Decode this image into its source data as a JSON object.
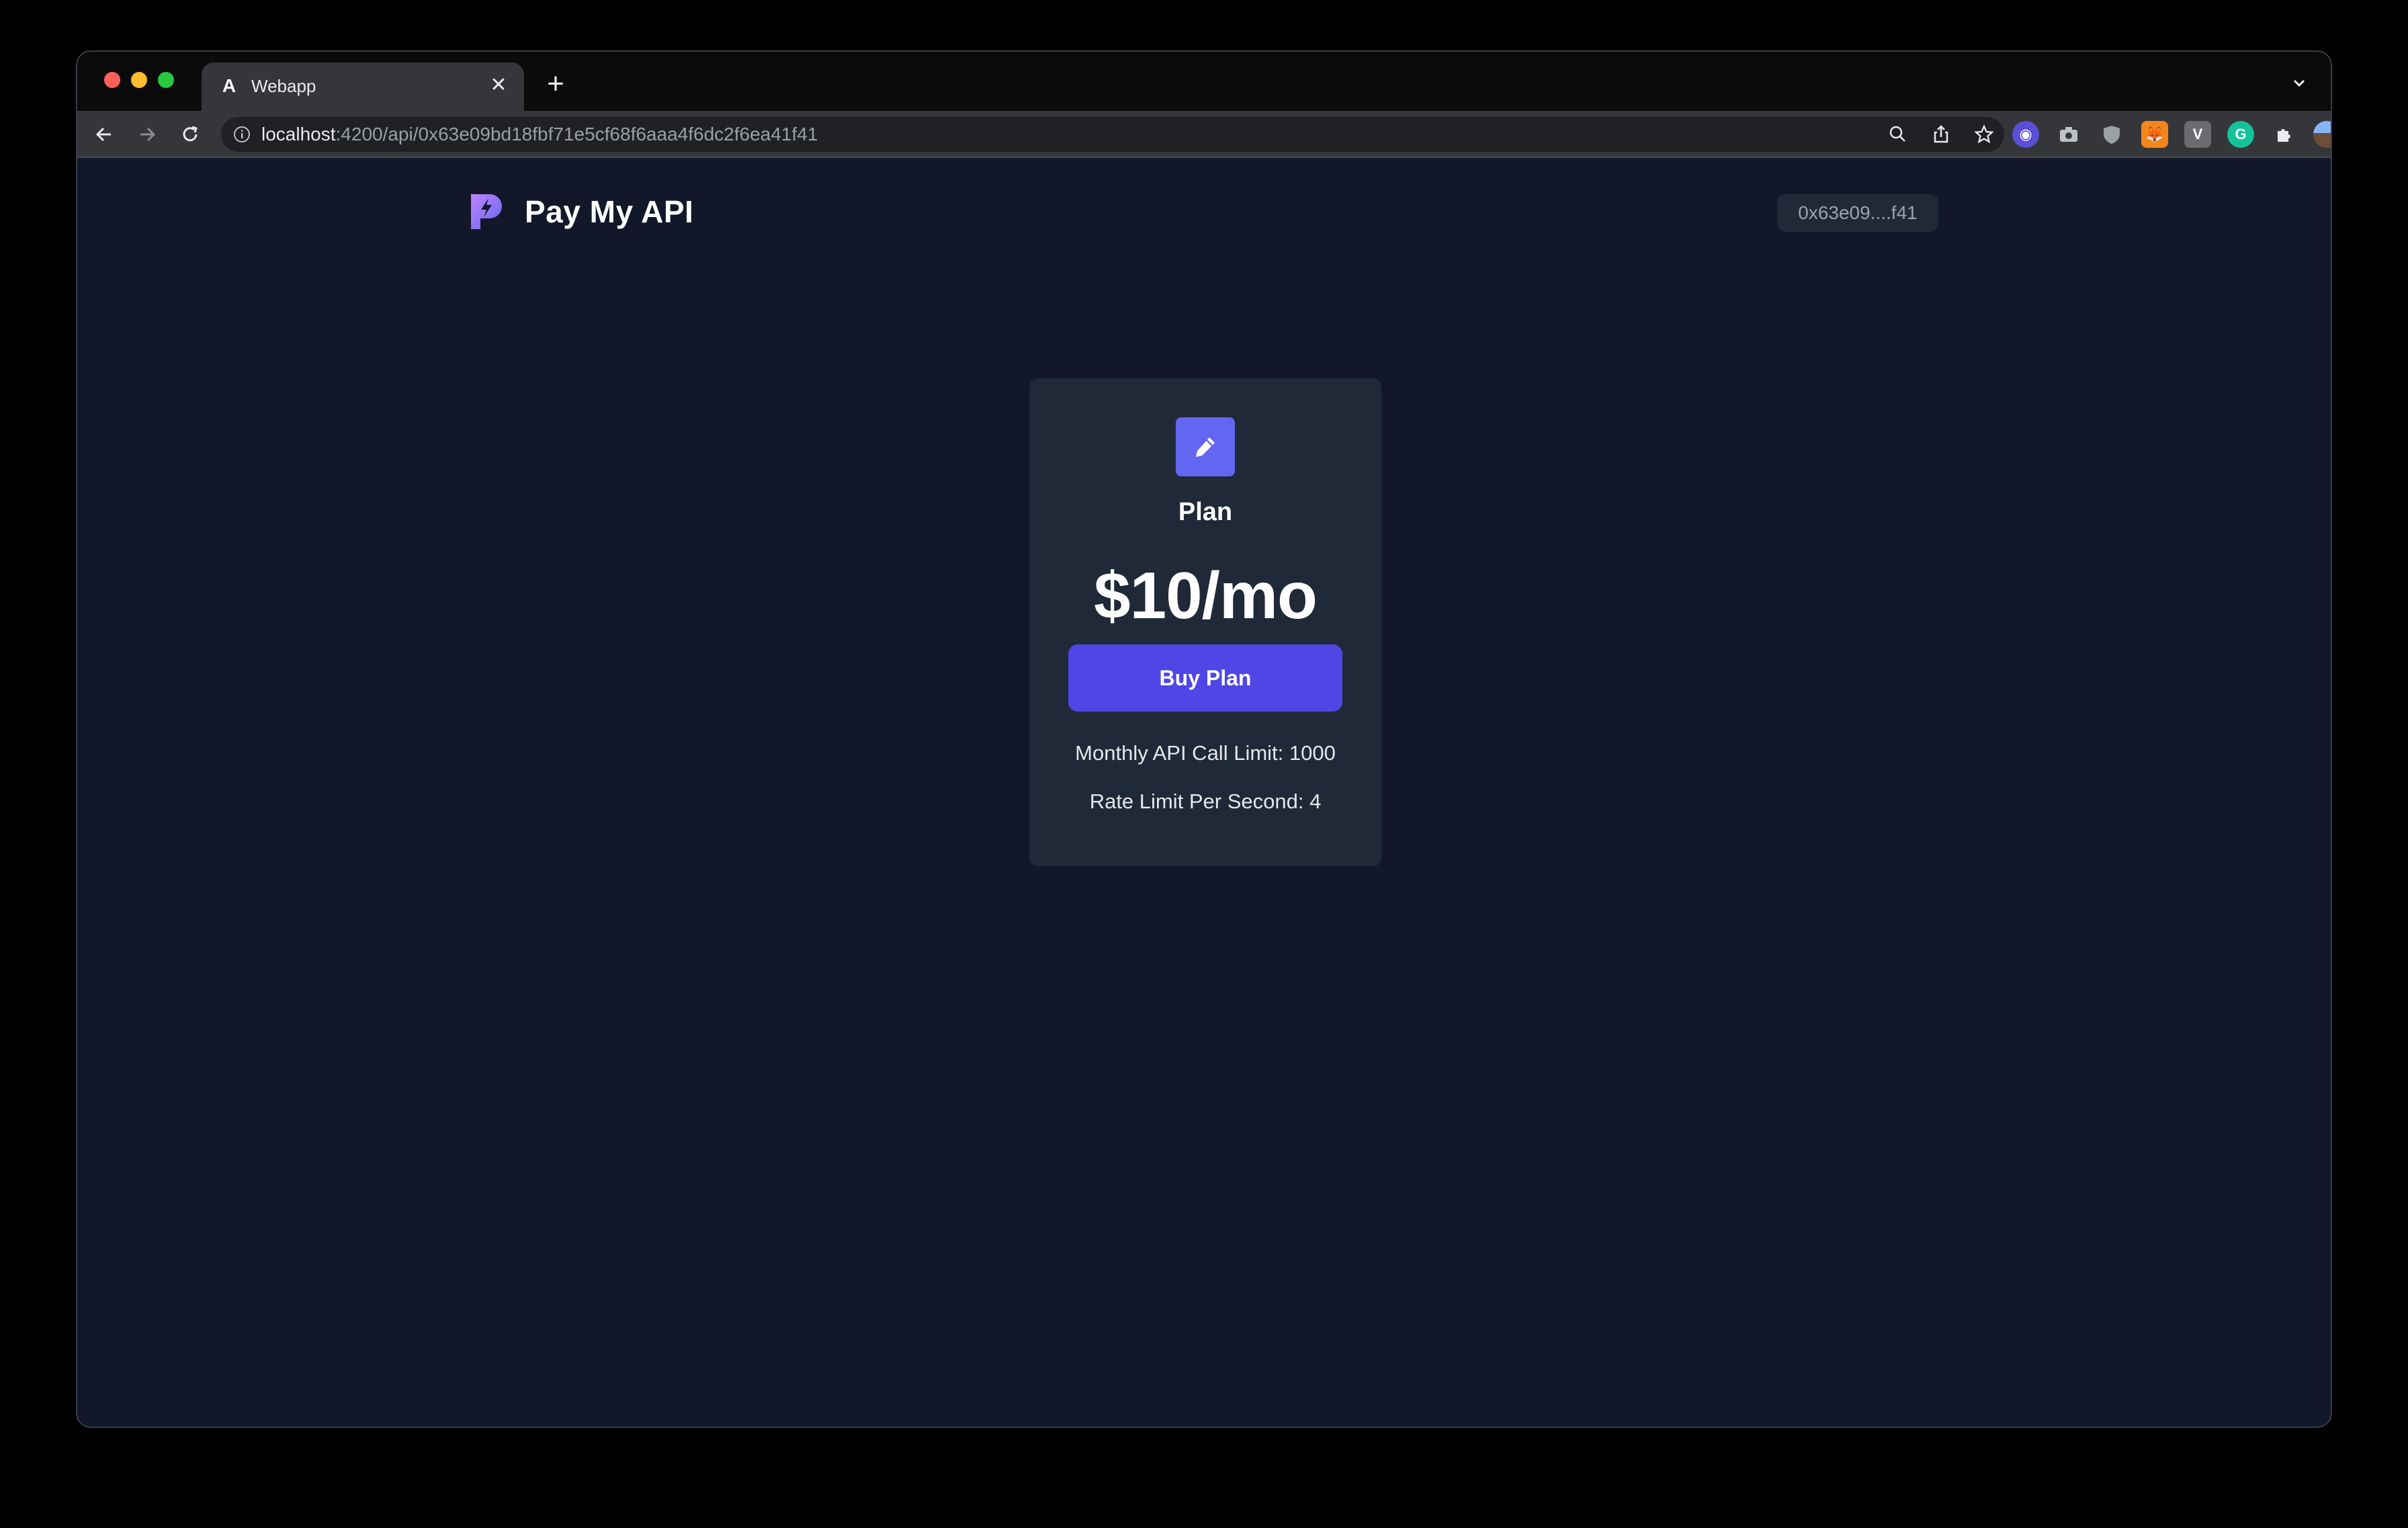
{
  "browser": {
    "tab_title": "Webapp",
    "tab_favicon": "A",
    "url_host": "localhost",
    "url_rest": ":4200/api/0x63e09bd18fbf71e5cf68f6aaa4f6dc2f6ea41f41"
  },
  "header": {
    "brand_name": "Pay My API",
    "wallet_address": "0x63e09....f41"
  },
  "plan_card": {
    "icon": "pencil-icon",
    "title": "Plan",
    "price": "$10/mo",
    "buy_label": "Buy Plan",
    "features": [
      "Monthly API Call Limit: 1000",
      "Rate Limit Per Second: 4"
    ]
  },
  "colors": {
    "page_bg": "#121829",
    "card_bg": "#1f2937",
    "accent": "#4f46e5",
    "icon_bg": "#6366f1"
  }
}
